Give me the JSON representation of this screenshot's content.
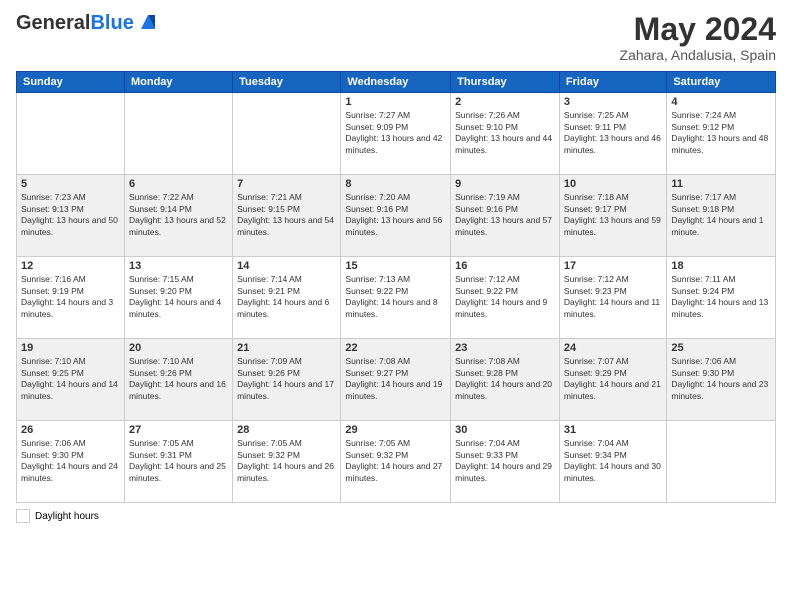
{
  "header": {
    "logo_general": "General",
    "logo_blue": "Blue",
    "month_title": "May 2024",
    "location": "Zahara, Andalusia, Spain"
  },
  "days_of_week": [
    "Sunday",
    "Monday",
    "Tuesday",
    "Wednesday",
    "Thursday",
    "Friday",
    "Saturday"
  ],
  "weeks": [
    [
      {
        "num": "",
        "sunrise": "",
        "sunset": "",
        "daylight": ""
      },
      {
        "num": "",
        "sunrise": "",
        "sunset": "",
        "daylight": ""
      },
      {
        "num": "",
        "sunrise": "",
        "sunset": "",
        "daylight": ""
      },
      {
        "num": "1",
        "sunrise": "Sunrise: 7:27 AM",
        "sunset": "Sunset: 9:09 PM",
        "daylight": "Daylight: 13 hours and 42 minutes."
      },
      {
        "num": "2",
        "sunrise": "Sunrise: 7:26 AM",
        "sunset": "Sunset: 9:10 PM",
        "daylight": "Daylight: 13 hours and 44 minutes."
      },
      {
        "num": "3",
        "sunrise": "Sunrise: 7:25 AM",
        "sunset": "Sunset: 9:11 PM",
        "daylight": "Daylight: 13 hours and 46 minutes."
      },
      {
        "num": "4",
        "sunrise": "Sunrise: 7:24 AM",
        "sunset": "Sunset: 9:12 PM",
        "daylight": "Daylight: 13 hours and 48 minutes."
      }
    ],
    [
      {
        "num": "5",
        "sunrise": "Sunrise: 7:23 AM",
        "sunset": "Sunset: 9:13 PM",
        "daylight": "Daylight: 13 hours and 50 minutes."
      },
      {
        "num": "6",
        "sunrise": "Sunrise: 7:22 AM",
        "sunset": "Sunset: 9:14 PM",
        "daylight": "Daylight: 13 hours and 52 minutes."
      },
      {
        "num": "7",
        "sunrise": "Sunrise: 7:21 AM",
        "sunset": "Sunset: 9:15 PM",
        "daylight": "Daylight: 13 hours and 54 minutes."
      },
      {
        "num": "8",
        "sunrise": "Sunrise: 7:20 AM",
        "sunset": "Sunset: 9:16 PM",
        "daylight": "Daylight: 13 hours and 56 minutes."
      },
      {
        "num": "9",
        "sunrise": "Sunrise: 7:19 AM",
        "sunset": "Sunset: 9:16 PM",
        "daylight": "Daylight: 13 hours and 57 minutes."
      },
      {
        "num": "10",
        "sunrise": "Sunrise: 7:18 AM",
        "sunset": "Sunset: 9:17 PM",
        "daylight": "Daylight: 13 hours and 59 minutes."
      },
      {
        "num": "11",
        "sunrise": "Sunrise: 7:17 AM",
        "sunset": "Sunset: 9:18 PM",
        "daylight": "Daylight: 14 hours and 1 minute."
      }
    ],
    [
      {
        "num": "12",
        "sunrise": "Sunrise: 7:16 AM",
        "sunset": "Sunset: 9:19 PM",
        "daylight": "Daylight: 14 hours and 3 minutes."
      },
      {
        "num": "13",
        "sunrise": "Sunrise: 7:15 AM",
        "sunset": "Sunset: 9:20 PM",
        "daylight": "Daylight: 14 hours and 4 minutes."
      },
      {
        "num": "14",
        "sunrise": "Sunrise: 7:14 AM",
        "sunset": "Sunset: 9:21 PM",
        "daylight": "Daylight: 14 hours and 6 minutes."
      },
      {
        "num": "15",
        "sunrise": "Sunrise: 7:13 AM",
        "sunset": "Sunset: 9:22 PM",
        "daylight": "Daylight: 14 hours and 8 minutes."
      },
      {
        "num": "16",
        "sunrise": "Sunrise: 7:12 AM",
        "sunset": "Sunset: 9:22 PM",
        "daylight": "Daylight: 14 hours and 9 minutes."
      },
      {
        "num": "17",
        "sunrise": "Sunrise: 7:12 AM",
        "sunset": "Sunset: 9:23 PM",
        "daylight": "Daylight: 14 hours and 11 minutes."
      },
      {
        "num": "18",
        "sunrise": "Sunrise: 7:11 AM",
        "sunset": "Sunset: 9:24 PM",
        "daylight": "Daylight: 14 hours and 13 minutes."
      }
    ],
    [
      {
        "num": "19",
        "sunrise": "Sunrise: 7:10 AM",
        "sunset": "Sunset: 9:25 PM",
        "daylight": "Daylight: 14 hours and 14 minutes."
      },
      {
        "num": "20",
        "sunrise": "Sunrise: 7:10 AM",
        "sunset": "Sunset: 9:26 PM",
        "daylight": "Daylight: 14 hours and 16 minutes."
      },
      {
        "num": "21",
        "sunrise": "Sunrise: 7:09 AM",
        "sunset": "Sunset: 9:26 PM",
        "daylight": "Daylight: 14 hours and 17 minutes."
      },
      {
        "num": "22",
        "sunrise": "Sunrise: 7:08 AM",
        "sunset": "Sunset: 9:27 PM",
        "daylight": "Daylight: 14 hours and 19 minutes."
      },
      {
        "num": "23",
        "sunrise": "Sunrise: 7:08 AM",
        "sunset": "Sunset: 9:28 PM",
        "daylight": "Daylight: 14 hours and 20 minutes."
      },
      {
        "num": "24",
        "sunrise": "Sunrise: 7:07 AM",
        "sunset": "Sunset: 9:29 PM",
        "daylight": "Daylight: 14 hours and 21 minutes."
      },
      {
        "num": "25",
        "sunrise": "Sunrise: 7:06 AM",
        "sunset": "Sunset: 9:30 PM",
        "daylight": "Daylight: 14 hours and 23 minutes."
      }
    ],
    [
      {
        "num": "26",
        "sunrise": "Sunrise: 7:06 AM",
        "sunset": "Sunset: 9:30 PM",
        "daylight": "Daylight: 14 hours and 24 minutes."
      },
      {
        "num": "27",
        "sunrise": "Sunrise: 7:05 AM",
        "sunset": "Sunset: 9:31 PM",
        "daylight": "Daylight: 14 hours and 25 minutes."
      },
      {
        "num": "28",
        "sunrise": "Sunrise: 7:05 AM",
        "sunset": "Sunset: 9:32 PM",
        "daylight": "Daylight: 14 hours and 26 minutes."
      },
      {
        "num": "29",
        "sunrise": "Sunrise: 7:05 AM",
        "sunset": "Sunset: 9:32 PM",
        "daylight": "Daylight: 14 hours and 27 minutes."
      },
      {
        "num": "30",
        "sunrise": "Sunrise: 7:04 AM",
        "sunset": "Sunset: 9:33 PM",
        "daylight": "Daylight: 14 hours and 29 minutes."
      },
      {
        "num": "31",
        "sunrise": "Sunrise: 7:04 AM",
        "sunset": "Sunset: 9:34 PM",
        "daylight": "Daylight: 14 hours and 30 minutes."
      },
      {
        "num": "",
        "sunrise": "",
        "sunset": "",
        "daylight": ""
      }
    ]
  ],
  "legend": {
    "daylight_label": "Daylight hours"
  }
}
